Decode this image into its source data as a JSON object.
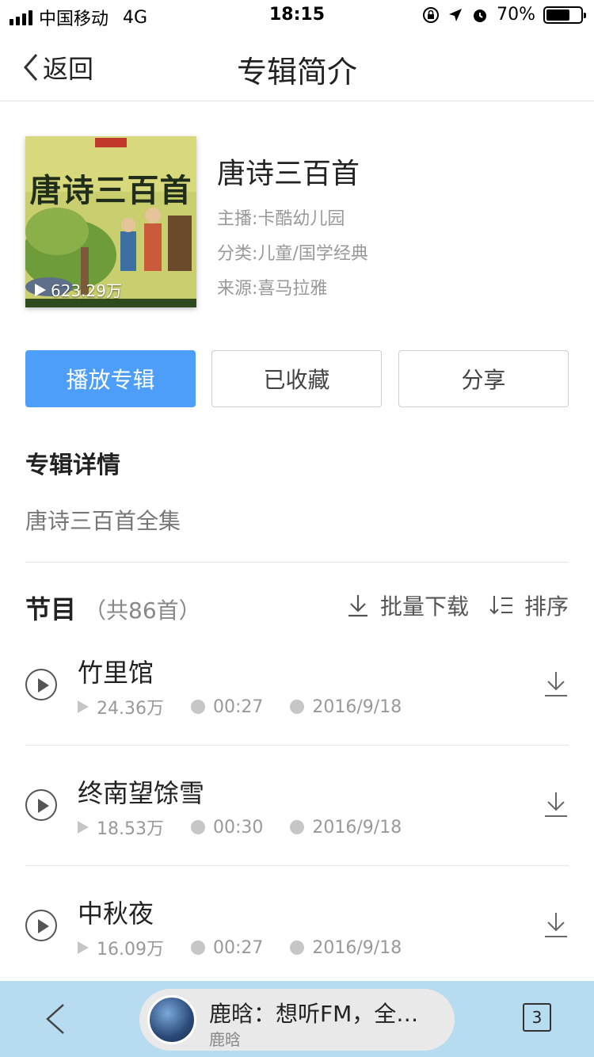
{
  "status_bar": {
    "carrier": "中国移动",
    "network": "4G",
    "time": "18:15",
    "battery": "70%",
    "battery_level": 0.7
  },
  "nav": {
    "back_label": "返回",
    "title": "专辑简介"
  },
  "album": {
    "cover_text": "唐诗三百首",
    "cover_plays": "623.29万",
    "name": "唐诗三百首",
    "host": "主播:卡酷幼儿园",
    "category": "分类:儿童/国学经典",
    "source": "来源:喜马拉雅"
  },
  "buttons": {
    "play": "播放专辑",
    "favorited": "已收藏",
    "share": "分享"
  },
  "details": {
    "heading": "专辑详情",
    "description": "唐诗三百首全集"
  },
  "programs": {
    "label": "节目",
    "count": "（共86首）",
    "batch_download": "批量下载",
    "sort": "排序",
    "tracks": [
      {
        "title": "竹里馆",
        "plays": "24.36万",
        "duration": "00:27",
        "date": "2016/9/18"
      },
      {
        "title": "终南望馀雪",
        "plays": "18.53万",
        "duration": "00:30",
        "date": "2016/9/18"
      },
      {
        "title": "中秋夜",
        "plays": "16.09万",
        "duration": "00:27",
        "date": "2016/9/18"
      }
    ]
  },
  "bottom_bar": {
    "title": "鹿晗：想听FM，全…",
    "subtitle": "鹿晗",
    "tab_count": "3"
  },
  "colors": {
    "primary": "#4d9ef9",
    "bottom_bar_bg": "#b7dcef"
  }
}
